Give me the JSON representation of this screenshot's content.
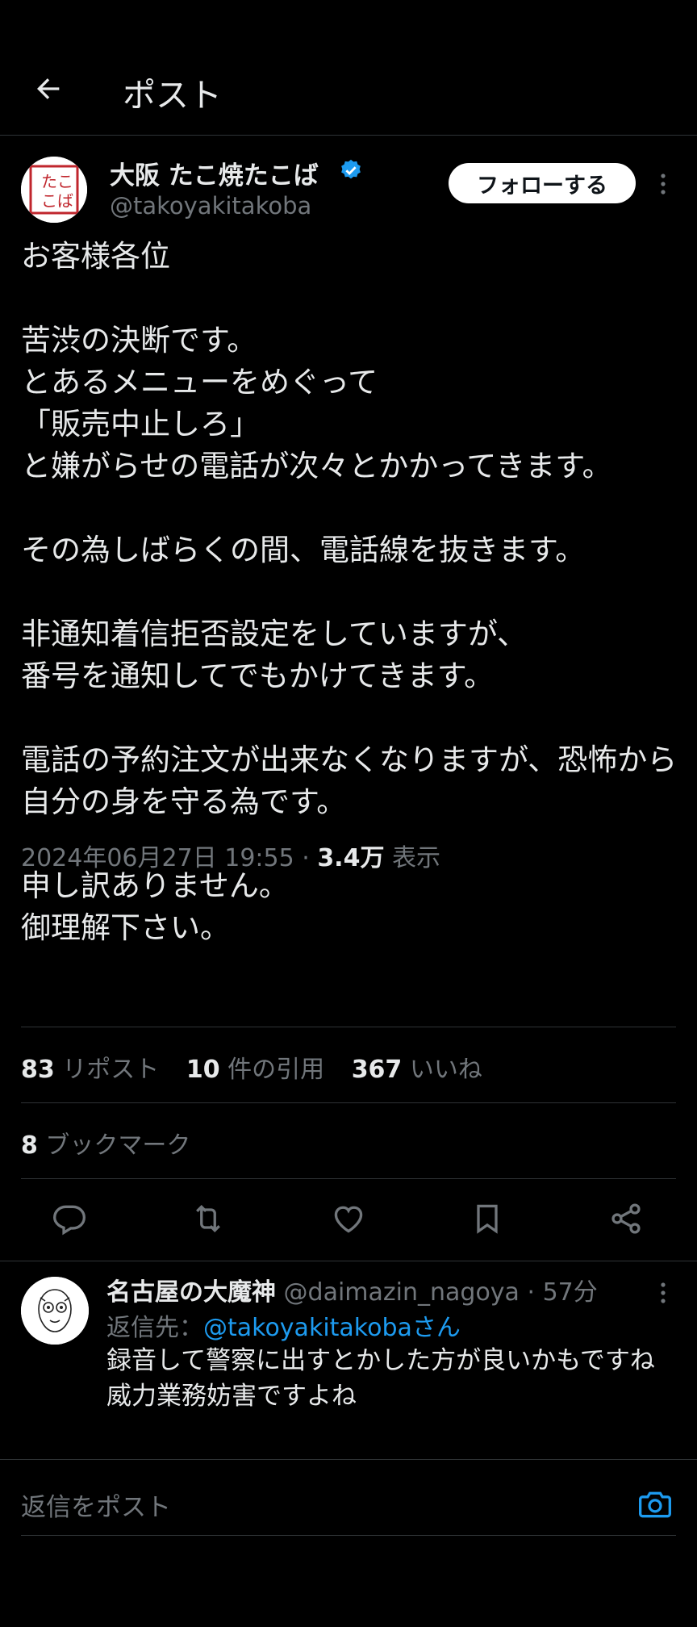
{
  "header": {
    "title": "ポスト",
    "back_icon": "arrow-left-icon"
  },
  "post": {
    "author_name": "大阪 たこ焼たこば",
    "avatar_text": "たこ焼たこば",
    "handle": "@takoyakitakoba",
    "follow_label": "フォローする",
    "body": "お客様各位\n\n苦渋の決断です。\nとあるメニューをめぐって\n「販売中止しろ」\nと嫌がらせの電話が次々とかかってきます。\n\nその為しばらくの間、電話線を抜きます。\n\n非通知着信拒否設定をしていますが、\n番号を通知してでもかけてきます。\n\n電話の予約注文が出来なくなりますが、恐怖から自分の身を守る為です。\n\n申し訳ありません。\n御理解下さい。",
    "timestamp": "2024年06月27日 19:55",
    "views_value": "3.4万",
    "views_label": "表示",
    "reposts_count": "83",
    "reposts_label": "リポスト",
    "quotes_count": "10",
    "quotes_label": "件の引用",
    "likes_count": "367",
    "likes_label": "いいね",
    "bookmarks_count": "8",
    "bookmarks_label": "ブックマーク"
  },
  "actions": [
    "reply-icon",
    "repost-icon",
    "like-icon",
    "bookmark-icon",
    "share-icon"
  ],
  "reply": {
    "name": "名古屋の大魔神",
    "handle": "@daimazin_nagoya",
    "time": "57分",
    "reply_to_label": "返信先：",
    "reply_to_handle": "@takoyakitakobaさん",
    "text": "録音して警察に出すとかした方が良いかもですね\n威力業務妨害ですよね"
  },
  "compose": {
    "placeholder": "返信をポスト",
    "camera_icon": "camera-icon"
  },
  "colors": {
    "background": "#000000",
    "accent": "#1d9bf0",
    "secondary_text": "#71767b",
    "divider": "#2f3336"
  }
}
